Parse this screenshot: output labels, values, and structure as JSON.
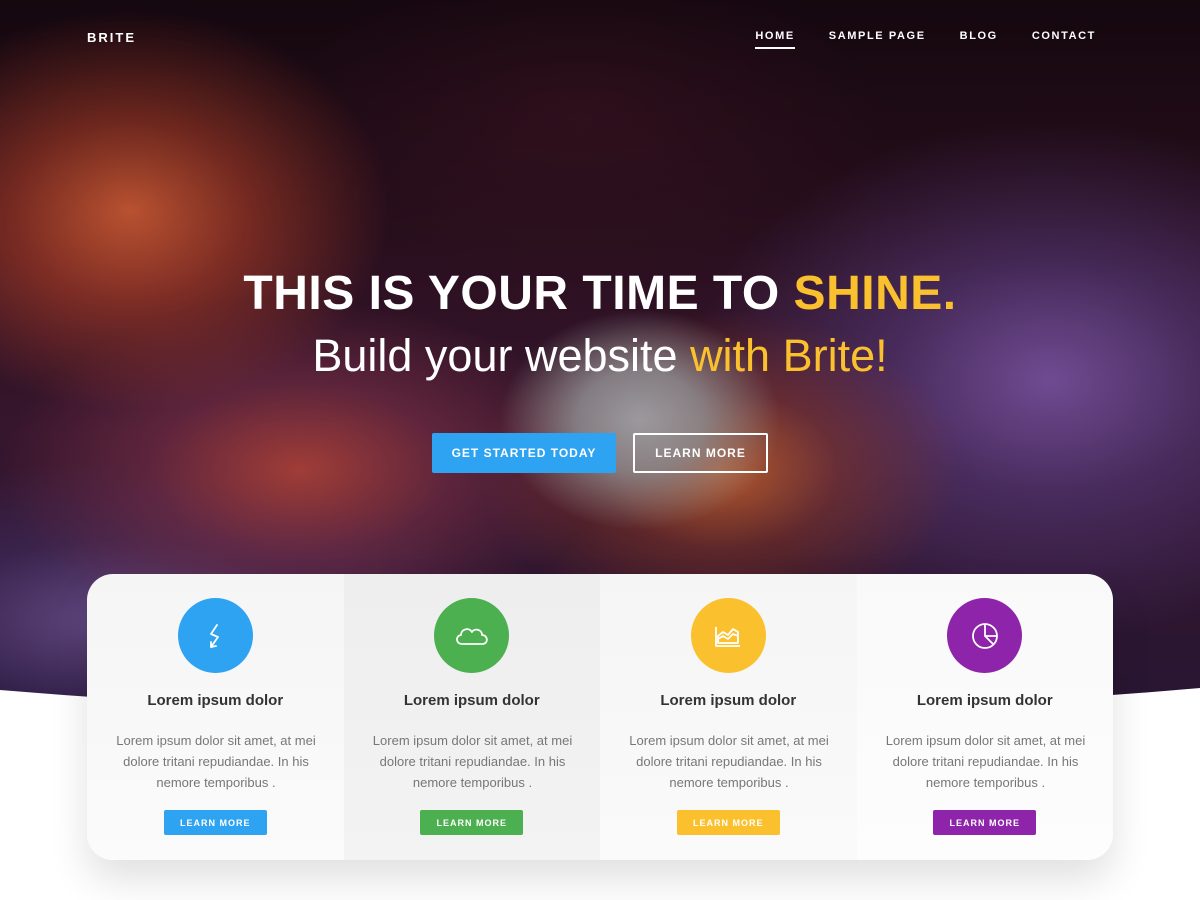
{
  "brand": {
    "logo": "BRITE"
  },
  "nav": {
    "items": [
      {
        "label": "HOME",
        "active": true
      },
      {
        "label": "SAMPLE PAGE",
        "active": false
      },
      {
        "label": "BLOG",
        "active": false
      },
      {
        "label": "CONTACT",
        "active": false
      }
    ]
  },
  "hero": {
    "headline_main": "THIS IS YOUR TIME TO ",
    "headline_accent": "SHINE.",
    "subline_main": "Build your website ",
    "subline_accent": "with Brite!",
    "primary_button": "GET STARTED TODAY",
    "secondary_button": "LEARN MORE",
    "accent_color": "#fbc02d",
    "primary_color": "#2ea3f2"
  },
  "features": [
    {
      "icon": "bolt-icon",
      "color": "#2ea3f2",
      "title": "Lorem ipsum dolor",
      "text": "Lorem ipsum dolor sit amet, at mei dolore tritani repudiandae. In his nemore temporibus .",
      "button": "LEARN MORE"
    },
    {
      "icon": "cloud-icon",
      "color": "#4caf50",
      "title": "Lorem ipsum dolor",
      "text": "Lorem ipsum dolor sit amet, at mei dolore tritani repudiandae. In his nemore temporibus .",
      "button": "LEARN MORE"
    },
    {
      "icon": "area-chart-icon",
      "color": "#fbc02d",
      "title": "Lorem ipsum dolor",
      "text": "Lorem ipsum dolor sit amet, at mei dolore tritani repudiandae. In his nemore temporibus .",
      "button": "LEARN MORE"
    },
    {
      "icon": "pie-chart-icon",
      "color": "#8e24aa",
      "title": "Lorem ipsum dolor",
      "text": "Lorem ipsum dolor sit amet, at mei dolore tritani repudiandae. In his nemore temporibus .",
      "button": "LEARN MORE"
    }
  ]
}
